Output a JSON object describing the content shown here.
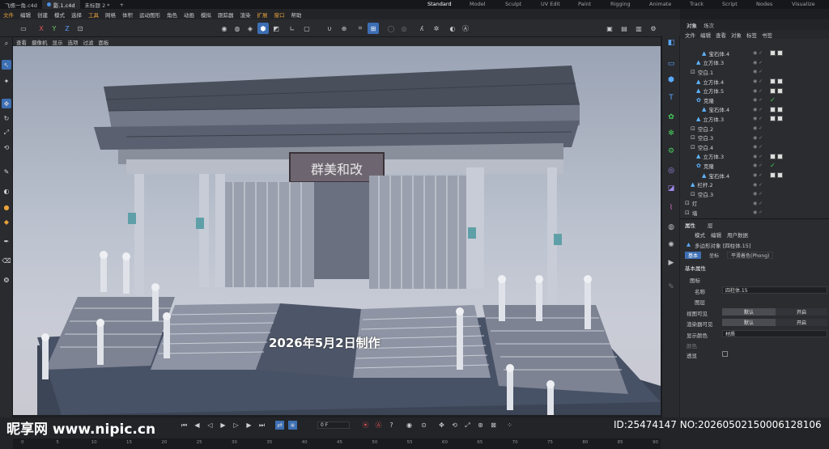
{
  "tabs": {
    "docs": [
      "飞檐一角.c4d",
      "影.1.c4d",
      "未标题 2 *"
    ],
    "layouts": [
      "Standard",
      "Model",
      "Sculpt",
      "UV Edit",
      "Paint",
      "Rigging",
      "Animate",
      "Track",
      "Script",
      "Nodes",
      "Visualize"
    ],
    "active_layout": "Standard"
  },
  "menu": [
    "文件",
    "编辑",
    "创建",
    "模式",
    "选择",
    "工具",
    "网格",
    "体积",
    "运动图形",
    "角色",
    "动画",
    "模拟",
    "跟踪器",
    "渲染",
    "扩展",
    "窗口",
    "帮助"
  ],
  "viewport_menu": [
    "查看",
    "摄像机",
    "显示",
    "选项",
    "过滤",
    "面板"
  ],
  "viewport": {
    "overlay_text": "2026年5月2日制作",
    "plaque_text": "群美和改"
  },
  "object_manager": {
    "tabs": [
      "对象",
      "场次"
    ],
    "menu": [
      "文件",
      "编辑",
      "查看",
      "对象",
      "标签",
      "书签"
    ],
    "rows": [
      {
        "name": "宝石体.4",
        "type": "obj",
        "depth": 3,
        "tags": 2
      },
      {
        "name": "立方体.3",
        "type": "obj",
        "depth": 2,
        "tags": 0
      },
      {
        "name": "空白.1",
        "type": "null",
        "depth": 1,
        "tags": 0
      },
      {
        "name": "立方体.4",
        "type": "obj",
        "depth": 2,
        "tags": 2
      },
      {
        "name": "立方体.5",
        "type": "obj",
        "depth": 2,
        "tags": 2
      },
      {
        "name": "克隆",
        "type": "cloner",
        "depth": 2,
        "tags": 0,
        "check": true
      },
      {
        "name": "宝石体.4",
        "type": "obj",
        "depth": 3,
        "tags": 2
      },
      {
        "name": "立方体.3",
        "type": "obj",
        "depth": 2,
        "tags": 2
      },
      {
        "name": "空白.2",
        "type": "null",
        "depth": 1,
        "tags": 0
      },
      {
        "name": "空白.3",
        "type": "null",
        "depth": 1,
        "tags": 0
      },
      {
        "name": "空白.4",
        "type": "null",
        "depth": 1,
        "tags": 0
      },
      {
        "name": "立方体.3",
        "type": "obj",
        "depth": 2,
        "tags": 2
      },
      {
        "name": "克隆",
        "type": "cloner",
        "depth": 2,
        "tags": 0,
        "check": true
      },
      {
        "name": "宝石体.4",
        "type": "obj",
        "depth": 3,
        "tags": 2
      },
      {
        "name": "栏杆.2",
        "type": "obj",
        "depth": 1,
        "tags": 0
      },
      {
        "name": "空白.3",
        "type": "null",
        "depth": 1,
        "tags": 0
      },
      {
        "name": "灯",
        "type": "null",
        "depth": 0,
        "tags": 0
      },
      {
        "name": "墙",
        "type": "null",
        "depth": 0,
        "tags": 0
      }
    ]
  },
  "attributes": {
    "tabs": [
      "属性",
      "层"
    ],
    "menu": [
      "模式",
      "编辑",
      "用户数据"
    ],
    "object_title": "多边形对象 [四柱体.15]",
    "subtabs": [
      "基本",
      "坐标",
      "平滑着色(Phong)"
    ],
    "section": "基本属性",
    "group": "图标",
    "name_label": "名称",
    "name_value": "四柱体.15",
    "layer_label": "图层",
    "viewport_visible_label": "视图可见",
    "render_visible_label": "渲染器可见",
    "default_label": "默认",
    "on_label": "开启",
    "display_color_label": "显示颜色",
    "display_color_value": "材质",
    "color_label": "颜色",
    "xray_label": "透显"
  },
  "timeline": {
    "frame_field": "0 F",
    "ticks": [
      "0",
      "5",
      "10",
      "15",
      "20",
      "25",
      "30",
      "35",
      "40",
      "45",
      "50",
      "55",
      "60",
      "65",
      "70",
      "75",
      "80",
      "85",
      "90"
    ]
  },
  "watermarks": {
    "left": "昵享网 www.nipic.cn",
    "right": "ID:25474147 NO:20260502150006128106"
  },
  "colors": {
    "accent": "#3d6fb4",
    "highlight": "#e9a33a",
    "check": "#46d05a"
  }
}
